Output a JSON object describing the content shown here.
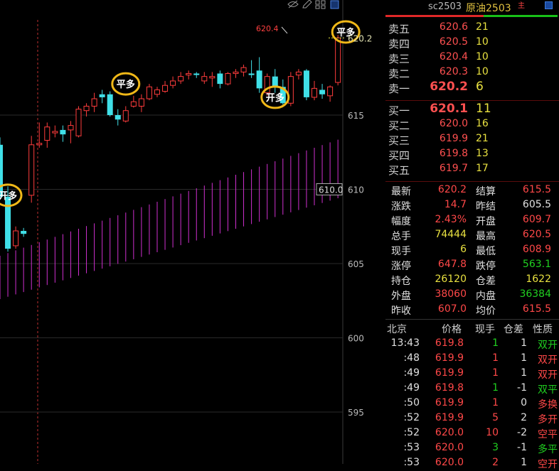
{
  "header": {
    "symbol": "sc2503",
    "name": "原油2503",
    "main_tag": "主"
  },
  "toolbar_icons": [
    "eye-off-icon",
    "pencil-icon",
    "grid-icon",
    "panel-toggle-icon"
  ],
  "asks": [
    {
      "label": "卖五",
      "price": "620.6",
      "vol": "21"
    },
    {
      "label": "卖四",
      "price": "620.5",
      "vol": "10"
    },
    {
      "label": "卖三",
      "price": "620.4",
      "vol": "10"
    },
    {
      "label": "卖二",
      "price": "620.3",
      "vol": "10"
    },
    {
      "label": "卖一",
      "price": "620.2",
      "vol": "6"
    }
  ],
  "bids": [
    {
      "label": "买一",
      "price": "620.1",
      "vol": "11"
    },
    {
      "label": "买二",
      "price": "620.0",
      "vol": "16"
    },
    {
      "label": "买三",
      "price": "619.9",
      "vol": "21"
    },
    {
      "label": "买四",
      "price": "619.8",
      "vol": "13"
    },
    {
      "label": "买五",
      "price": "619.7",
      "vol": "17"
    }
  ],
  "stats": [
    {
      "l1": "最新",
      "v1": "620.2",
      "c1": "red",
      "l2": "结算",
      "v2": "615.5",
      "c2": "red"
    },
    {
      "l1": "涨跌",
      "v1": "14.7",
      "c1": "red",
      "l2": "昨结",
      "v2": "605.5",
      "c2": "wht"
    },
    {
      "l1": "幅度",
      "v1": "2.43%",
      "c1": "red",
      "l2": "开盘",
      "v2": "609.7",
      "c2": "red"
    },
    {
      "l1": "总手",
      "v1": "74444",
      "c1": "yel",
      "l2": "最高",
      "v2": "620.5",
      "c2": "red"
    },
    {
      "l1": "现手",
      "v1": "6",
      "c1": "yel",
      "l2": "最低",
      "v2": "608.9",
      "c2": "red"
    },
    {
      "l1": "涨停",
      "v1": "647.8",
      "c1": "red",
      "l2": "跌停",
      "v2": "563.1",
      "c2": "grn"
    },
    {
      "l1": "持仓",
      "v1": "26120",
      "c1": "yel",
      "l2": "仓差",
      "v2": "1622",
      "c2": "yel"
    },
    {
      "l1": "外盘",
      "v1": "38060",
      "c1": "red",
      "l2": "内盘",
      "v2": "36384",
      "c2": "grn"
    },
    {
      "l1": "昨收",
      "v1": "607.0",
      "c1": "red",
      "l2": "均价",
      "v2": "615.5",
      "c2": "red"
    }
  ],
  "ticks_header": {
    "time": "北京",
    "price": "价格",
    "qty": "现手",
    "oi": "仓差",
    "nature": "性质"
  },
  "ticks": [
    {
      "time": "13:43",
      "price": "619.8",
      "qty": "1",
      "qc": "grn",
      "oi": "1",
      "nature": "双开",
      "nc": "grn"
    },
    {
      "time": ":48",
      "price": "619.9",
      "qty": "1",
      "qc": "red",
      "oi": "1",
      "nature": "双开",
      "nc": "red"
    },
    {
      "time": ":49",
      "price": "619.9",
      "qty": "1",
      "qc": "red",
      "oi": "1",
      "nature": "双开",
      "nc": "red"
    },
    {
      "time": ":49",
      "price": "619.8",
      "qty": "1",
      "qc": "grn",
      "oi": "-1",
      "nature": "双平",
      "nc": "grn"
    },
    {
      "time": ":50",
      "price": "619.9",
      "qty": "1",
      "qc": "red",
      "oi": "0",
      "nature": "多换",
      "nc": "red"
    },
    {
      "time": ":52",
      "price": "619.9",
      "qty": "5",
      "qc": "red",
      "oi": "2",
      "nature": "多开",
      "nc": "red"
    },
    {
      "time": ":52",
      "price": "620.0",
      "qty": "10",
      "qc": "red",
      "oi": "-2",
      "nature": "空平",
      "nc": "red"
    },
    {
      "time": ":53",
      "price": "620.0",
      "qty": "3",
      "qc": "grn",
      "oi": "-1",
      "nature": "多平",
      "nc": "grn"
    },
    {
      "time": ":53",
      "price": "620.0",
      "qty": "2",
      "qc": "red",
      "oi": "1",
      "nature": "空开",
      "nc": "red"
    }
  ],
  "chart_data": {
    "type": "candlestick",
    "y_ticks": [
      "620.2",
      "615",
      "610",
      "605",
      "600",
      "595"
    ],
    "y_tick_values": [
      620.2,
      615,
      610,
      605,
      600,
      595
    ],
    "ylim": [
      592.5,
      622.5
    ],
    "last_price_label": "620.2",
    "high_label": "620.4",
    "crosshair_label": "610.0",
    "crosshair_value": 610.0,
    "colors": {
      "up": "#ff3c3c",
      "down": "#40e0e8",
      "volume": "#d030d0"
    },
    "candles": [
      {
        "o": 613,
        "h": 613.5,
        "c": 609.5,
        "l": 609.3
      },
      {
        "o": 609.5,
        "h": 610.2,
        "c": 606,
        "l": 605.8
      },
      {
        "o": 606.2,
        "h": 607.5,
        "c": 607.2,
        "l": 606
      },
      {
        "o": 607.2,
        "h": 607.4,
        "c": 607,
        "l": 606.8
      },
      {
        "o": 609.6,
        "h": 613.6,
        "c": 613,
        "l": 609.1
      },
      {
        "o": 613,
        "h": 614.5,
        "c": 613.1,
        "l": 612.8
      },
      {
        "o": 613.3,
        "h": 614.5,
        "c": 614.2,
        "l": 612.8
      },
      {
        "o": 613.8,
        "h": 614.3,
        "c": 613.9,
        "l": 613.5
      },
      {
        "o": 614,
        "h": 614.3,
        "c": 613.7,
        "l": 613.2
      },
      {
        "o": 614,
        "h": 614.6,
        "c": 614.3,
        "l": 613.1
      },
      {
        "o": 613.6,
        "h": 615.6,
        "c": 615.4,
        "l": 613.5
      },
      {
        "o": 615.3,
        "h": 615.8,
        "c": 615.6,
        "l": 614.9
      },
      {
        "o": 615.6,
        "h": 616.5,
        "c": 616.1,
        "l": 615.2
      },
      {
        "o": 616.4,
        "h": 616.7,
        "c": 616.2,
        "l": 615.8
      },
      {
        "o": 616.4,
        "h": 616.6,
        "c": 615,
        "l": 614.9
      },
      {
        "o": 615,
        "h": 615.4,
        "c": 614.7,
        "l": 614.3
      },
      {
        "o": 614.6,
        "h": 615.6,
        "c": 615.3,
        "l": 614.5
      },
      {
        "o": 615.6,
        "h": 616.3,
        "c": 615.9,
        "l": 615.5
      },
      {
        "o": 615.6,
        "h": 616.4,
        "c": 616.1,
        "l": 615.2
      },
      {
        "o": 616.1,
        "h": 617.1,
        "c": 616.9,
        "l": 616
      },
      {
        "o": 616.4,
        "h": 616.9,
        "c": 616.7,
        "l": 616.2
      },
      {
        "o": 616.6,
        "h": 617.3,
        "c": 617,
        "l": 616.5
      },
      {
        "o": 617,
        "h": 617.6,
        "c": 617.3,
        "l": 616.8
      },
      {
        "o": 617.3,
        "h": 617.9,
        "c": 617.6,
        "l": 617.1
      },
      {
        "o": 617.7,
        "h": 618,
        "c": 617.8,
        "l": 617.4
      },
      {
        "o": 617.8,
        "h": 617.9,
        "c": 617.7,
        "l": 617.5
      },
      {
        "o": 617.3,
        "h": 617.9,
        "c": 617.6,
        "l": 617.1
      },
      {
        "o": 617.5,
        "h": 617.9,
        "c": 617.6,
        "l": 616.9
      },
      {
        "o": 617.8,
        "h": 618,
        "c": 617.1,
        "l": 616.8
      },
      {
        "o": 617.1,
        "h": 617.9,
        "c": 617.8,
        "l": 617
      },
      {
        "o": 617.8,
        "h": 618.1,
        "c": 617.9,
        "l": 617.5
      },
      {
        "o": 617.9,
        "h": 618.4,
        "c": 618.2,
        "l": 617.6
      },
      {
        "o": 617.8,
        "h": 618.7,
        "c": 617.7,
        "l": 617.5
      },
      {
        "o": 618,
        "h": 618.9,
        "c": 616.8,
        "l": 616.5
      },
      {
        "o": 616.5,
        "h": 617.8,
        "c": 617.6,
        "l": 616.3
      },
      {
        "o": 617.6,
        "h": 618.1,
        "c": 616.9,
        "l": 616.5
      },
      {
        "o": 616.9,
        "h": 617.4,
        "c": 615.8,
        "l": 615.7
      },
      {
        "o": 615.8,
        "h": 617.9,
        "c": 617.6,
        "l": 615.6
      },
      {
        "o": 617.7,
        "h": 618.1,
        "c": 617.9,
        "l": 617.4
      },
      {
        "o": 618,
        "h": 618.1,
        "c": 616.2,
        "l": 616
      },
      {
        "o": 616.2,
        "h": 617.3,
        "c": 616.8,
        "l": 616
      },
      {
        "o": 616.7,
        "h": 617.1,
        "c": 616.4,
        "l": 616.1
      },
      {
        "o": 616.3,
        "h": 617,
        "c": 616.9,
        "l": 615.9
      },
      {
        "o": 617.2,
        "h": 620.4,
        "c": 620.2,
        "l": 617
      }
    ]
  },
  "annotations": [
    {
      "text": "开多",
      "value": 609.6,
      "bar": 1
    },
    {
      "text": "平多",
      "value": 617.1,
      "bar": 16
    },
    {
      "text": "开多",
      "value": 616.2,
      "bar": 35
    },
    {
      "text": "平多",
      "value": 620.6,
      "bar": 44
    }
  ]
}
